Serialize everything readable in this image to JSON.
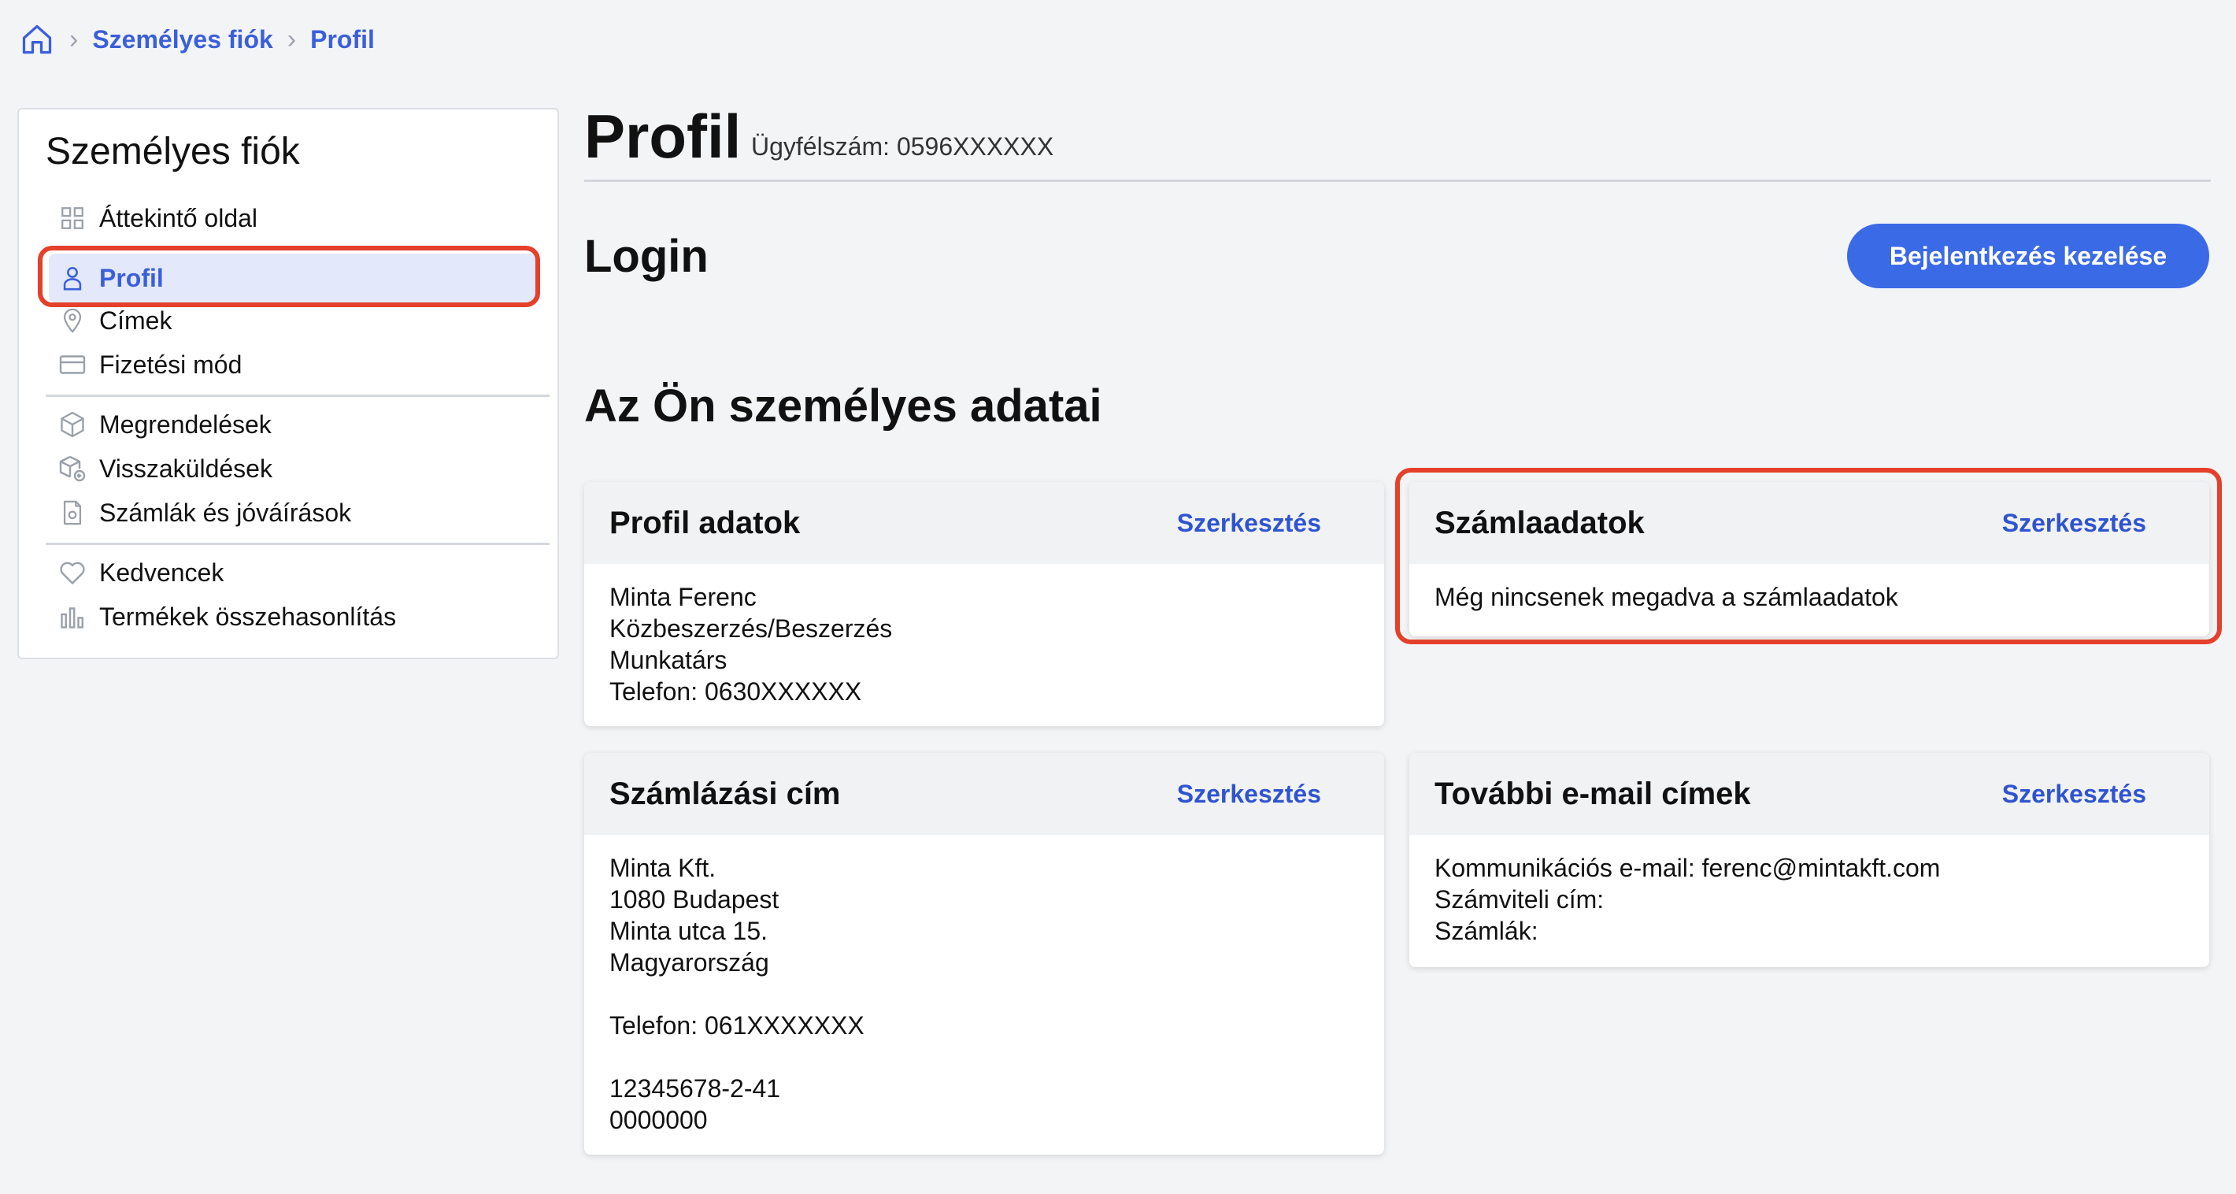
{
  "breadcrumb": {
    "home_icon": "home-icon",
    "items": [
      "Személyes fiók",
      "Profil"
    ]
  },
  "sidebar": {
    "title": "Személyes fiók",
    "items": [
      {
        "label": "Áttekintő oldal",
        "icon": "grid-icon"
      },
      {
        "label": "Profil",
        "icon": "user-icon",
        "active": true
      },
      {
        "label": "Címek",
        "icon": "location-pin-icon"
      },
      {
        "label": "Fizetési mód",
        "icon": "credit-card-icon"
      },
      {
        "label": "Megrendelések",
        "icon": "box-icon"
      },
      {
        "label": "Visszaküldések",
        "icon": "box-return-icon"
      },
      {
        "label": "Számlák és jóváírások",
        "icon": "invoice-icon"
      },
      {
        "label": "Kedvencek",
        "icon": "heart-icon"
      },
      {
        "label": "Termékek összehasonlítás",
        "icon": "bar-chart-icon"
      }
    ]
  },
  "main": {
    "title": "Profil",
    "customer_number": "Ügyfélszám: 0596XXXXXX",
    "login": {
      "title": "Login",
      "button_label": "Bejelentkezés kezelése"
    },
    "personal_section_title": "Az Ön személyes adatai",
    "cards": {
      "profil": {
        "title": "Profil adatok",
        "edit_label": "Szerkesztés",
        "lines": [
          "Minta Ferenc",
          "Közbeszerzés/Beszerzés",
          "Munkatárs",
          "Telefon: 0630XXXXXX"
        ]
      },
      "szamlaadatok": {
        "title": "Számlaadatok",
        "edit_label": "Szerkesztés",
        "lines": [
          "Még nincsenek megadva a számlaadatok"
        ]
      },
      "szamlazasi_cim": {
        "title": "Számlázási cím",
        "edit_label": "Szerkesztés",
        "lines": [
          "Minta Kft.",
          "1080 Budapest",
          "Minta utca 15.",
          "Magyarország",
          "",
          "Telefon: 061XXXXXXX",
          "",
          "12345678-2-41",
          "0000000"
        ]
      },
      "tovabbi_email": {
        "title": "További e-mail címek",
        "edit_label": "Szerkesztés",
        "lines": [
          "Kommunikációs e-mail: ferenc@mintakft.com",
          "Számviteli cím:",
          "Számlák:"
        ]
      }
    }
  },
  "colors": {
    "accent": "#3b6ae6",
    "link": "#2f54cf",
    "highlight": "#e4402b",
    "active_bg": "#e3e9fb"
  }
}
